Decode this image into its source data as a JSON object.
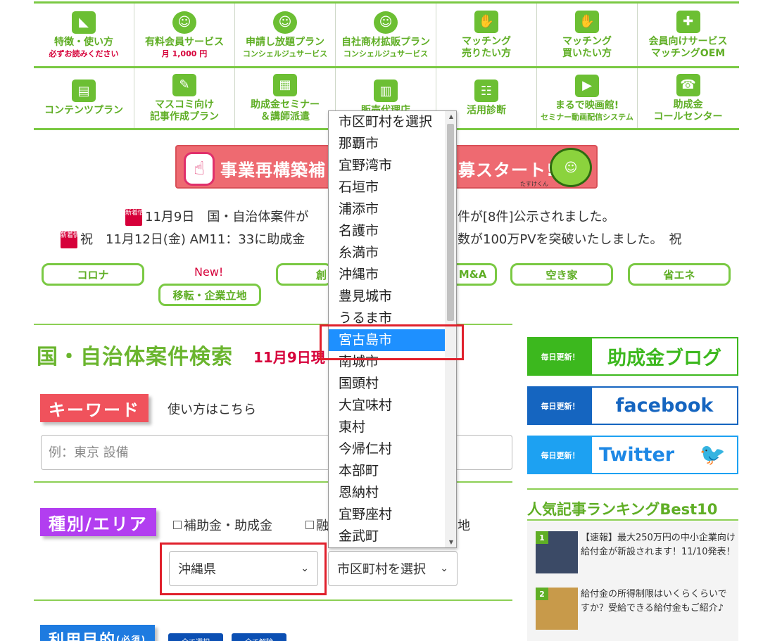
{
  "nav": {
    "row1": [
      {
        "icon": "beginner-mark-icon",
        "glyph": "◣",
        "l1": "特徴・使い方",
        "l2": "必ずお読みください",
        "l2_style": "red"
      },
      {
        "icon": "mascot-icon",
        "glyph": "☺",
        "l1": "有料会員サービス",
        "l2": "月 1,000 円",
        "l2_style": "red"
      },
      {
        "icon": "mascot-icon",
        "glyph": "☺",
        "l1": "申請し放題プラン",
        "l2": "コンシェルジュサービス",
        "l2_style": ""
      },
      {
        "icon": "mascot-icon",
        "glyph": "☺",
        "l1": "自社商材拡販プラン",
        "l2": "コンシェルジュサービス",
        "l2_style": ""
      },
      {
        "icon": "handshake-icon",
        "glyph": "✋",
        "l1": "マッチング",
        "l2": "売りたい方",
        "l2_style": "big"
      },
      {
        "icon": "handshake-icon",
        "glyph": "✋",
        "l1": "マッチング",
        "l2": "買いたい方",
        "l2_style": "big"
      },
      {
        "icon": "puzzle-icon",
        "glyph": "✚",
        "l1": "会員向けサービス",
        "l2": "マッチングOEM",
        "l2_style": "big"
      }
    ],
    "row2": [
      {
        "icon": "document-icon",
        "glyph": "▤",
        "l1": "コンテンツプラン",
        "l2": "",
        "l2_style": ""
      },
      {
        "icon": "book-pen-icon",
        "glyph": "✎",
        "l1": "マスコミ向け",
        "l2": "記事作成プラン",
        "l2_style": "big"
      },
      {
        "icon": "presentation-icon",
        "glyph": "▦",
        "l1": "助成金セミナー",
        "l2": "＆講師派遣",
        "l2_style": "big"
      },
      {
        "icon": "building-icon",
        "glyph": "▥",
        "l1": "販売代理店",
        "l2": "",
        "l2_style": ""
      },
      {
        "icon": "clipboard-icon",
        "glyph": "☷",
        "l1": "活用診断",
        "l2": "",
        "l2_style": ""
      },
      {
        "icon": "video-camera-icon",
        "glyph": "▶",
        "l1": "まるで映画館!",
        "l2": "セミナー動画配信システム",
        "l2_style": ""
      },
      {
        "icon": "headset-icon",
        "glyph": "☎",
        "l1": "助成金",
        "l2": "コールセンター",
        "l2_style": "big"
      }
    ]
  },
  "banner": {
    "text_left": "事業再構築補",
    "text_right": "募スタート!",
    "sub": "たすけくん"
  },
  "news": [
    {
      "badge": "新着情報",
      "text": "11月9日　国・自治体案件が",
      "text_right": "件が[8件]公示されました。"
    },
    {
      "badge": "新着情報",
      "text": "祝　11月12日(金) AM11：33に助成金",
      "text_right": "数が100万PVを突破いたしました。　祝"
    }
  ],
  "tags": {
    "corona": "コロナ",
    "new_label": "New!",
    "relocation": "移転・企業立地",
    "sougyou": "創",
    "ma": "M&A",
    "akiya": "空き家",
    "shoene": "省エネ"
  },
  "main": {
    "title": "国・自治体案件検索",
    "title_date": "11月9日現",
    "keyword_label": "キーワード",
    "usage_link": "使い方はこちら",
    "search_placeholder": "例：東京 設備",
    "type_area_label": "種別/エリア",
    "cb_subsidy": "補助金・助成金",
    "cb_loan": "融",
    "cb_other": "地",
    "prefecture_select": "沖縄県",
    "city_select": "市区町村を選択",
    "purpose_label": "利用目的",
    "purpose_sub": "(必須)",
    "select_all": "全て選択",
    "clear_all": "全て解除"
  },
  "dropdown": {
    "items": [
      "市区町村を選択",
      "那覇市",
      "宜野湾市",
      "石垣市",
      "浦添市",
      "名護市",
      "糸満市",
      "沖縄市",
      "豊見城市",
      "うるま市",
      "宮古島市",
      "南城市",
      "国頭村",
      "大宜味村",
      "東村",
      "今帰仁村",
      "本部町",
      "恩納村",
      "宜野座村",
      "金武町"
    ],
    "selected": "宮古島市"
  },
  "side": {
    "badge": "毎日更新！",
    "blog": "助成金ブログ",
    "facebook": "facebook",
    "twitter": "Twitter",
    "ranking_title": "人気記事ランキングBest10",
    "ranking": [
      {
        "num": "1",
        "text": "【速報】最大250万円の中小企業向け給付金が新設されます！11/10発表！"
      },
      {
        "num": "2",
        "text": "給付金の所得制限はいくらくらいですか？受給できる給付金もご紹介♪"
      }
    ]
  },
  "colors": {
    "green": "#6ab52e",
    "red": "#d6003a",
    "blue": "#1e90ff",
    "facebook": "#1565c0",
    "twitter": "#1da1f2"
  }
}
